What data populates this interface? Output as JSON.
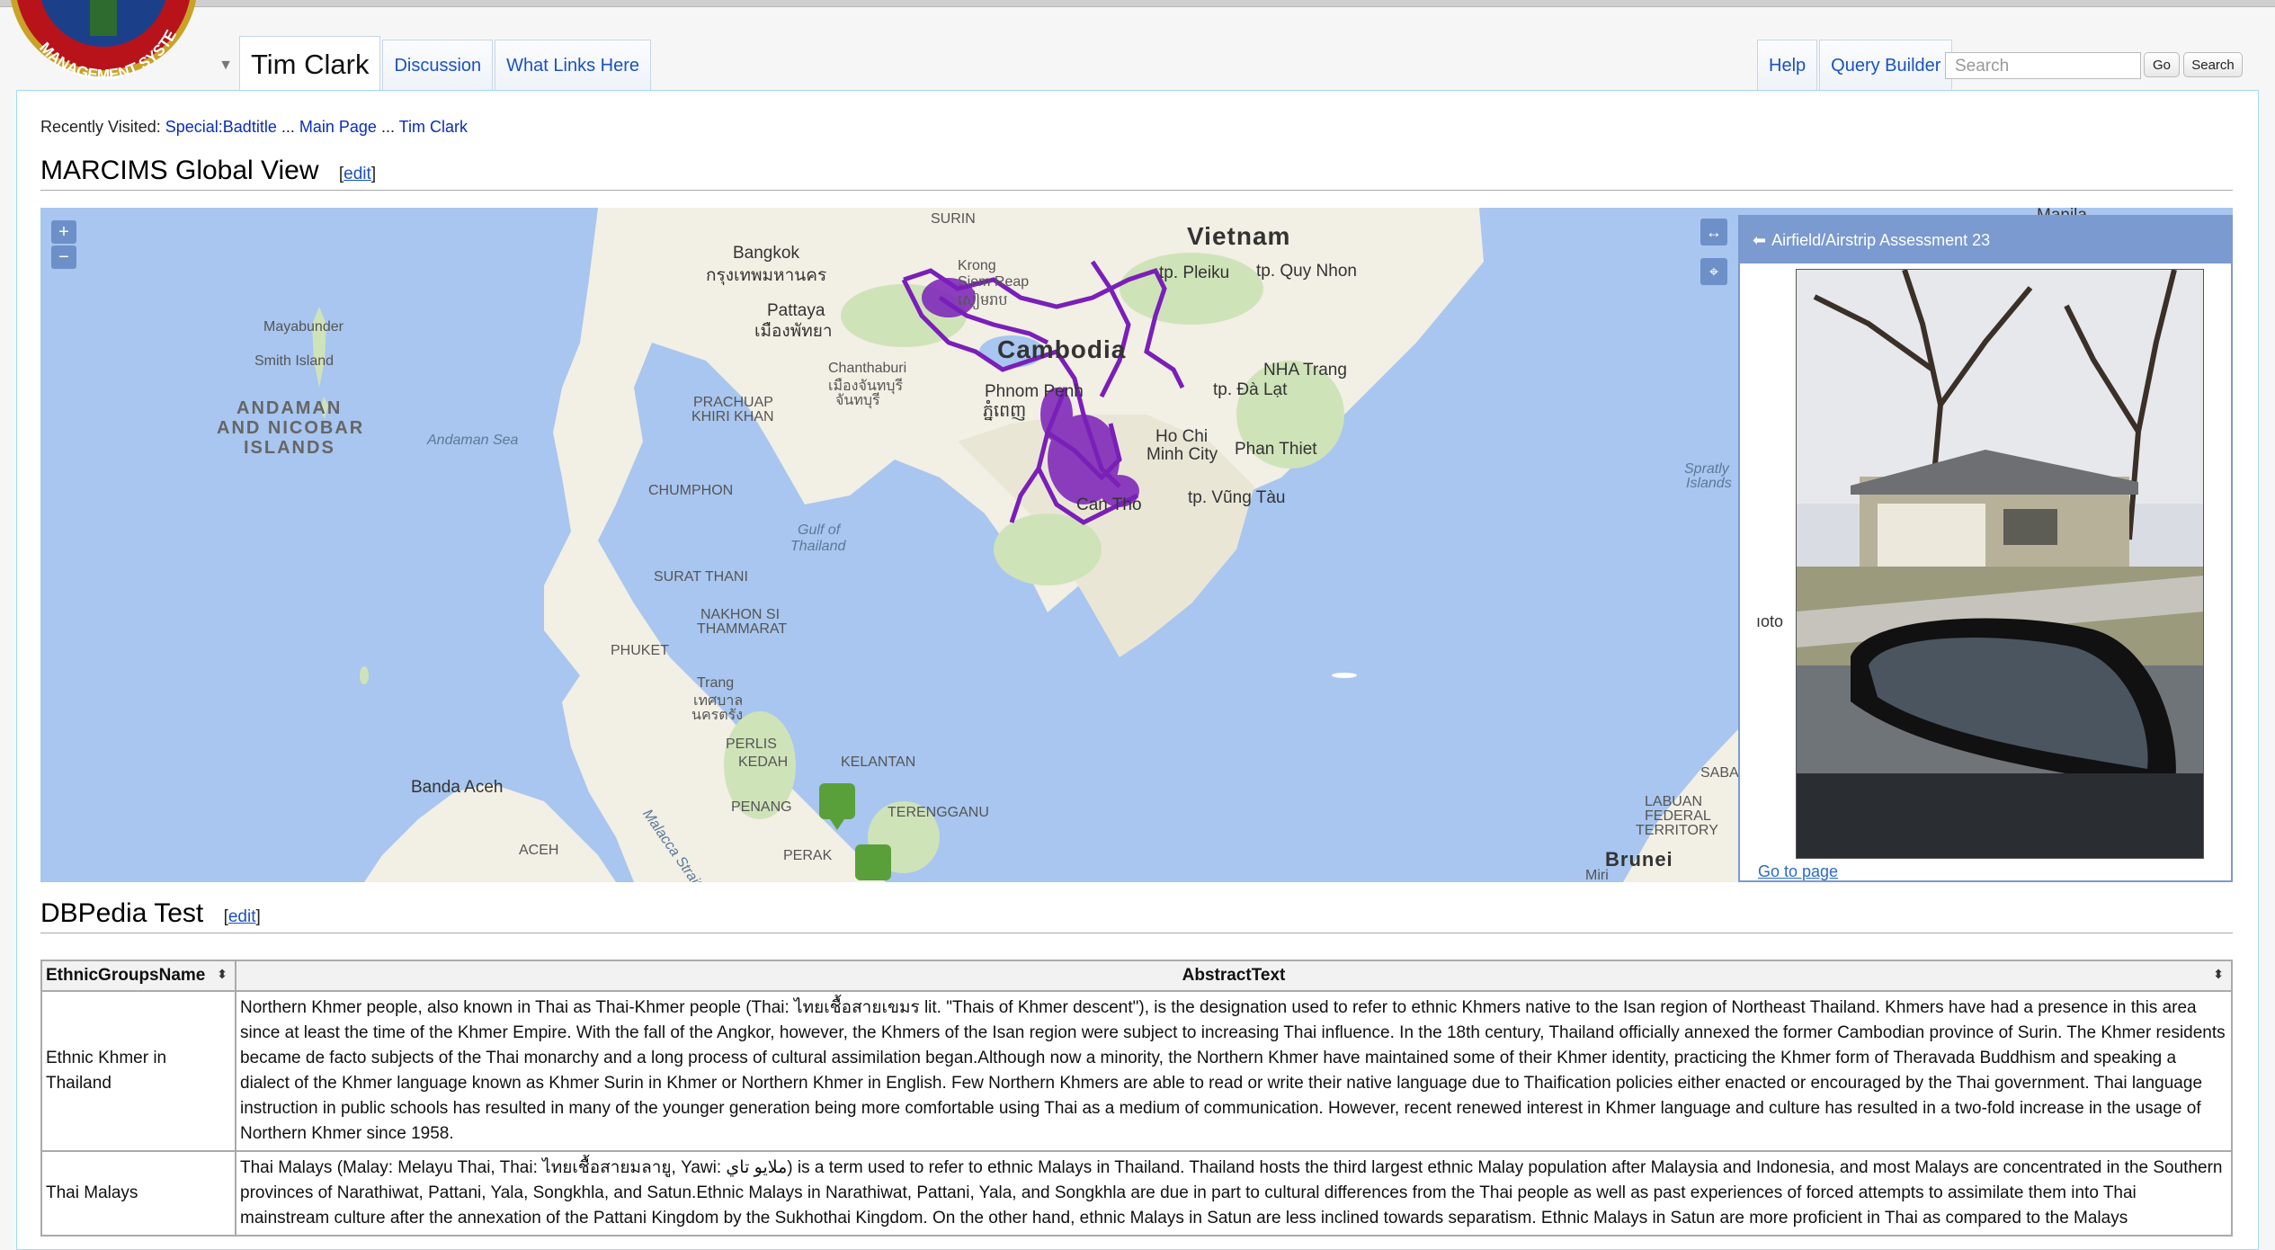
{
  "header": {
    "tabs_left": [
      {
        "label": "Tim Clark",
        "active": true
      },
      {
        "label": "Discussion"
      },
      {
        "label": "What Links Here"
      }
    ],
    "tabs_right": [
      {
        "label": "Help"
      },
      {
        "label": "Query Builder"
      }
    ],
    "search": {
      "placeholder": "Search",
      "go_label": "Go",
      "search_label": "Search"
    },
    "logo_text": "MANAGEMENT SYSTEM"
  },
  "recent": {
    "prefix": "Recently Visited:",
    "links": [
      "Special:Badtitle",
      "Main Page",
      "Tim Clark"
    ],
    "sep": "..."
  },
  "section1": {
    "title": "MARCIMS Global View",
    "edit": "edit"
  },
  "section2": {
    "title": "DBPedia Test",
    "edit": "edit"
  },
  "map": {
    "zoom_in": "+",
    "zoom_out": "−",
    "labels": {
      "surin": "SURIN",
      "vietnam": "Vietnam",
      "bangkok": "Bangkok",
      "bangkok_th": "กรุงเทพมหานคร",
      "krong": "Krong",
      "siem_reap": "Siem Reap",
      "siem_reap_km": "សៀមរាប",
      "pleiku": "tp. Pleiku",
      "quy_nhon": "tp. Quy Nhon",
      "pattaya": "Pattaya",
      "pattaya_th": "เมืองพัทยา",
      "cambodia": "Cambodia",
      "mayabunder": "Mayabunder",
      "smith_island": "Smith Island",
      "chanthaburi": "Chanthaburi",
      "chanthaburi_th": "เมืองจันทบุรี",
      "chanthaburi_th2": "จันทบุรี",
      "phnom_penh": "Phnom Penh",
      "phnom_penh_km": "ភ្នំពេញ",
      "nha_trang": "NHA Trang",
      "da_lat": "tp. Đà Lạt",
      "andaman": "ANDAMAN",
      "nicobar": "AND NICOBAR",
      "islands": "ISLANDS",
      "andaman_sea": "Andaman Sea",
      "prachuap": "PRACHUAP",
      "khiri_khan": "KHIRI KHAN",
      "hcmc1": "Ho Chi",
      "hcmc2": "Minh City",
      "phan_thiet": "Phan Thiet",
      "spratly1": "Spratly",
      "spratly2": "Islands",
      "chumphon": "CHUMPHON",
      "can_tho": "Can Tho",
      "vung_tau": "tp. Vũng Tàu",
      "gulf1": "Gulf of",
      "gulf2": "Thailand",
      "surat": "SURAT THANI",
      "nakhon1": "NAKHON SI",
      "nakhon2": "THAMMARAT",
      "phuket": "PHUKET",
      "trang": "Trang",
      "trang_th1": "เทศบาล",
      "trang_th2": "นครตรัง",
      "perlis": "PERLIS",
      "kedah": "KEDAH",
      "kelantan": "KELANTAN",
      "banda_aceh": "Banda Aceh",
      "terengganu": "TERENGGANU",
      "penang": "PENANG",
      "malacca": "Malacca Strait",
      "aceh": "ACEH",
      "perak": "PERAK",
      "labuan1": "LABUAN",
      "labuan2": "FEDERAL",
      "labuan3": "TERRITORY",
      "brunei": "Brunei",
      "sabah": "SABA",
      "manila": "Manila",
      "mir": "Miri"
    }
  },
  "popup": {
    "title": "Airfield/Airstrip Assessment 23",
    "side_text": "ıoto",
    "goto": "Go to page"
  },
  "table": {
    "headers": [
      "EthnicGroupsName",
      "AbstractText"
    ],
    "rows": [
      {
        "name": "Ethnic Khmer in Thailand",
        "text": "Northern Khmer people, also known in Thai as Thai-Khmer people (Thai: ไทยเชื้อสายเขมร lit. \"Thais of Khmer descent\"), is the designation used to refer to ethnic Khmers native to the Isan region of Northeast Thailand. Khmers have had a presence in this area since at least the time of the Khmer Empire. With the fall of the Angkor, however, the Khmers of the Isan region were subject to increasing Thai influence. In the 18th century, Thailand officially annexed the former Cambodian province of Surin. The Khmer residents became de facto subjects of the Thai monarchy and a long process of cultural assimilation began.Although now a minority, the Northern Khmer have maintained some of their Khmer identity, practicing the Khmer form of Theravada Buddhism and speaking a dialect of the Khmer language known as Khmer Surin in Khmer or Northern Khmer in English. Few Northern Khmers are able to read or write their native language due to Thaification policies either enacted or encouraged by the Thai government. Thai language instruction in public schools has resulted in many of the younger generation being more comfortable using Thai as a medium of communication. However, recent renewed interest in Khmer language and culture has resulted in a two-fold increase in the usage of Northern Khmer since 1958."
      },
      {
        "name": "Thai Malays",
        "text": "Thai Malays (Malay: Melayu Thai, Thai: ไทยเชื้อสายมลายู, Yawi: ملايو تاي) is a term used to refer to ethnic Malays in Thailand. Thailand hosts the third largest ethnic Malay population after Malaysia and Indonesia, and most Malays are concentrated in the Southern provinces of Narathiwat, Pattani, Yala, Songkhla, and Satun.Ethnic Malays in Narathiwat, Pattani, Yala, and Songkhla are due in part to cultural differences from the Thai people as well as past experiences of forced attempts to assimilate them into Thai mainstream culture after the annexation of the Pattani Kingdom by the Sukhothai Kingdom. On the other hand, ethnic Malays in Satun are less inclined towards separatism. Ethnic Malays in Satun are more proficient in Thai as compared to the Malays"
      }
    ]
  },
  "colors": {
    "link": "#0a2dbd",
    "map_sea": "#a8c6ef",
    "map_land": "#f2efe4",
    "overlay": "#7a1fb8",
    "popup_head": "#7a9ad0"
  }
}
